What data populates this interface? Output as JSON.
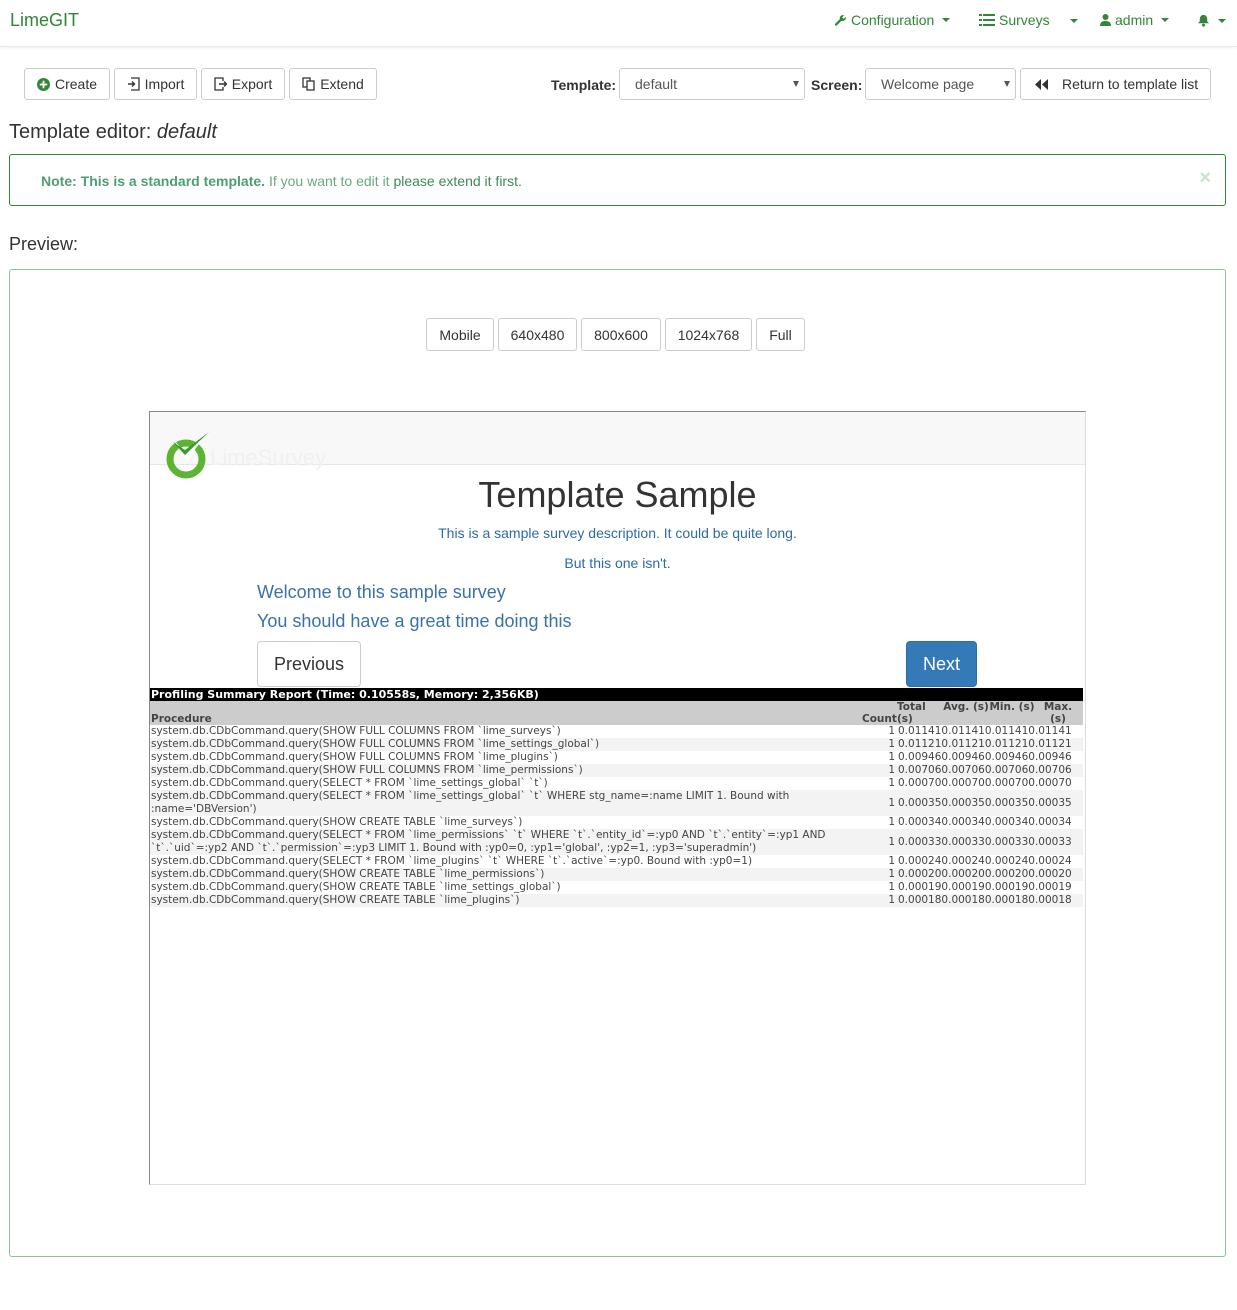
{
  "navbar": {
    "brand": "LimeGIT",
    "configuration": "Configuration",
    "surveys": "Surveys",
    "user": "admin"
  },
  "toolbar": {
    "create": "Create",
    "import": "Import",
    "export": "Export",
    "extend": "Extend",
    "template_label": "Template:",
    "template_value": "default",
    "screen_label": "Screen:",
    "screen_value": "Welcome page",
    "return": "Return to template list"
  },
  "editor": {
    "title_prefix": "Template editor:",
    "title_name": "default"
  },
  "alert": {
    "strong": "Note: This is a standard template.",
    "part1": " If you want to edit it",
    "part2": " please extend it first.",
    "close": "×"
  },
  "preview": {
    "label": "Preview:",
    "sizes": [
      "Mobile",
      "640x480",
      "800x600",
      "1024x768",
      "Full"
    ]
  },
  "survey": {
    "logo_text": "LimeSurvey",
    "title": "Template Sample",
    "desc1": "This is a sample survey description. It could be quite long.",
    "desc2": "But this one isn't.",
    "welcome1": "Welcome to this sample survey",
    "welcome2": "You should have a great time doing this",
    "previous": "Previous",
    "next": "Next"
  },
  "profiling": {
    "header": "Profiling Summary Report (Time: 0.10558s, Memory: 2,356KB)",
    "columns": [
      "Procedure",
      "Count",
      "Total (s)",
      "Avg. (s)",
      "Min. (s)",
      "Max. (s)"
    ],
    "rows": [
      {
        "proc": "system.db.CDbCommand.query(SHOW FULL COLUMNS FROM `lime_surveys`)",
        "count": "1",
        "times": "0.011410.011410.011410.01141"
      },
      {
        "proc": "system.db.CDbCommand.query(SHOW FULL COLUMNS FROM `lime_settings_global`)",
        "count": "1",
        "times": "0.011210.011210.011210.01121"
      },
      {
        "proc": "system.db.CDbCommand.query(SHOW FULL COLUMNS FROM `lime_plugins`)",
        "count": "1",
        "times": "0.009460.009460.009460.00946"
      },
      {
        "proc": "system.db.CDbCommand.query(SHOW FULL COLUMNS FROM `lime_permissions`)",
        "count": "1",
        "times": "0.007060.007060.007060.00706"
      },
      {
        "proc": "system.db.CDbCommand.query(SELECT * FROM `lime_settings_global` `t`)",
        "count": "1",
        "times": "0.000700.000700.000700.00070"
      },
      {
        "proc": "system.db.CDbCommand.query(SELECT * FROM `lime_settings_global` `t` WHERE stg_name=:name LIMIT 1. Bound with :name='DBVersion')",
        "count": "1",
        "times": "0.000350.000350.000350.00035"
      },
      {
        "proc": "system.db.CDbCommand.query(SHOW CREATE TABLE `lime_surveys`)",
        "count": "1",
        "times": "0.000340.000340.000340.00034"
      },
      {
        "proc": "system.db.CDbCommand.query(SELECT * FROM `lime_permissions` `t` WHERE `t`.`entity_id`=:yp0 AND `t`.`entity`=:yp1 AND `t`.`uid`=:yp2 AND `t`.`permission`=:yp3 LIMIT 1. Bound with :yp0=0, :yp1='global', :yp2=1, :yp3='superadmin')",
        "count": "1",
        "times": "0.000330.000330.000330.00033"
      },
      {
        "proc": "system.db.CDbCommand.query(SELECT * FROM `lime_plugins` `t` WHERE `t`.`active`=:yp0. Bound with :yp0=1)",
        "count": "1",
        "times": "0.000240.000240.000240.00024"
      },
      {
        "proc": "system.db.CDbCommand.query(SHOW CREATE TABLE `lime_permissions`)",
        "count": "1",
        "times": "0.000200.000200.000200.00020"
      },
      {
        "proc": "system.db.CDbCommand.query(SHOW CREATE TABLE `lime_settings_global`)",
        "count": "1",
        "times": "0.000190.000190.000190.00019"
      },
      {
        "proc": "system.db.CDbCommand.query(SHOW CREATE TABLE `lime_plugins`)",
        "count": "1",
        "times": "0.000180.000180.000180.00018"
      }
    ]
  },
  "colors": {
    "brand": "#328637",
    "primary": "#337ab7",
    "link": "#2f6aa3"
  }
}
